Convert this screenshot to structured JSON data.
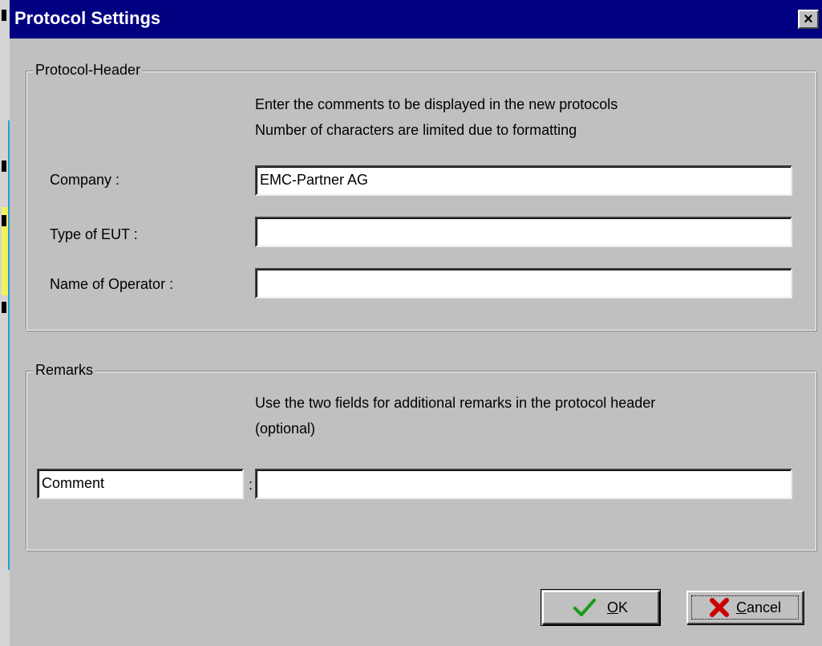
{
  "window": {
    "title": "Protocol Settings",
    "close_glyph": "×"
  },
  "protocol_header": {
    "label": "Protocol-Header",
    "instructions": [
      "Enter the comments to be displayed in the new protocols",
      "Number of characters are limited due to formatting"
    ],
    "fields": {
      "company": {
        "label": "Company :",
        "value": "EMC-Partner AG"
      },
      "type_of_eut": {
        "label": "Type of EUT :",
        "value": ""
      },
      "operator": {
        "label": "Name of Operator :",
        "value": ""
      }
    }
  },
  "remarks": {
    "label": "Remarks",
    "instructions": [
      "Use the two fields for additional remarks in the protocol header",
      "(optional)"
    ],
    "comment_name": "Comment",
    "separator": ":",
    "comment_value": ""
  },
  "buttons": {
    "ok": {
      "mnemonic": "O",
      "rest": "K",
      "icon": "checkmark-icon"
    },
    "cancel": {
      "mnemonic": "C",
      "rest": "ancel",
      "icon": "x-icon"
    }
  },
  "colors": {
    "titlebar": "#000080",
    "dialog": "#c0c0c0",
    "ok_icon": "#1a9a1a",
    "cancel_icon": "#cc0000"
  }
}
